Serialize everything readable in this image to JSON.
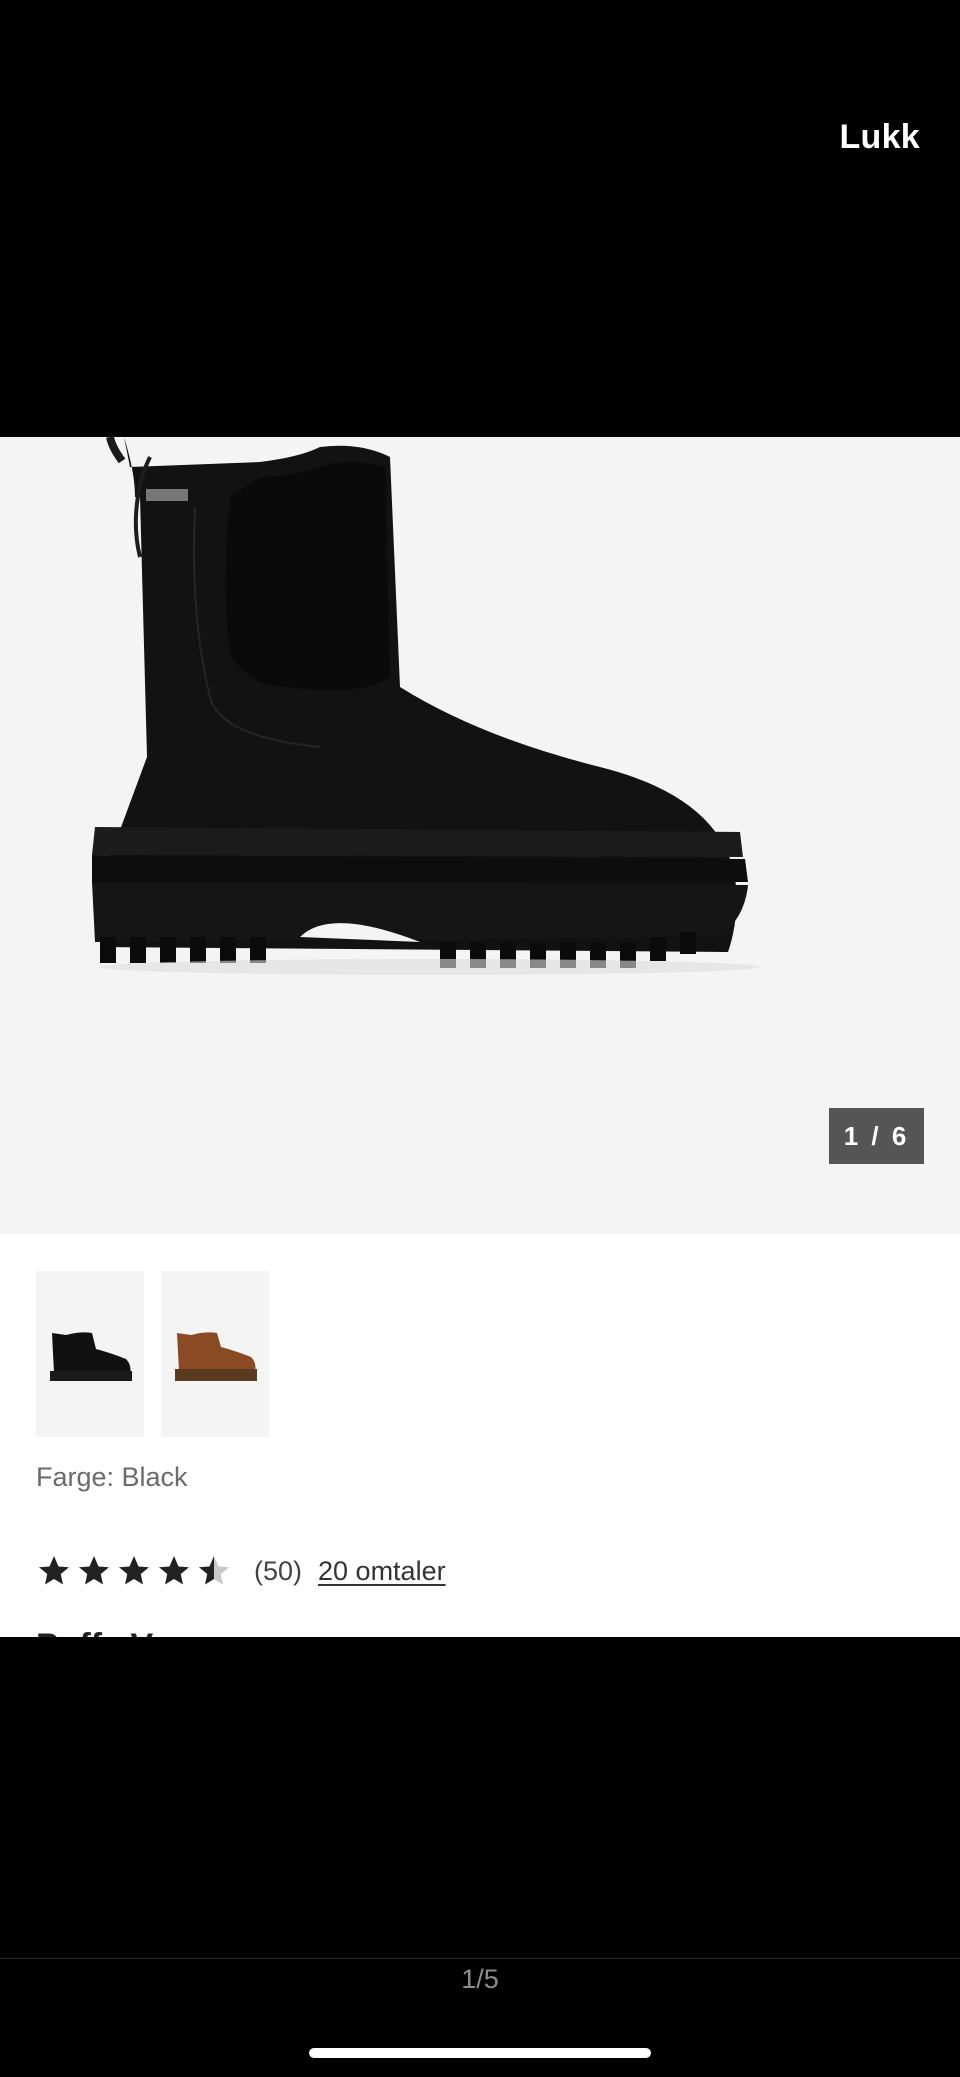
{
  "header": {
    "close_label": "Lukk"
  },
  "gallery": {
    "counter": "1 / 6",
    "thumbnails": [
      {
        "name": "black-boot-thumbnail",
        "color": "#111111"
      },
      {
        "name": "brown-boot-thumbnail",
        "color": "#8a4a24"
      }
    ]
  },
  "product": {
    "color_line": "Farge: Black",
    "rating": {
      "value": 4.5,
      "max": 5,
      "count": "(50)",
      "reviews_link": "20 omtaler"
    },
    "cut_heading": "Puffa Væ..."
  },
  "footer": {
    "pager": "1/5"
  }
}
